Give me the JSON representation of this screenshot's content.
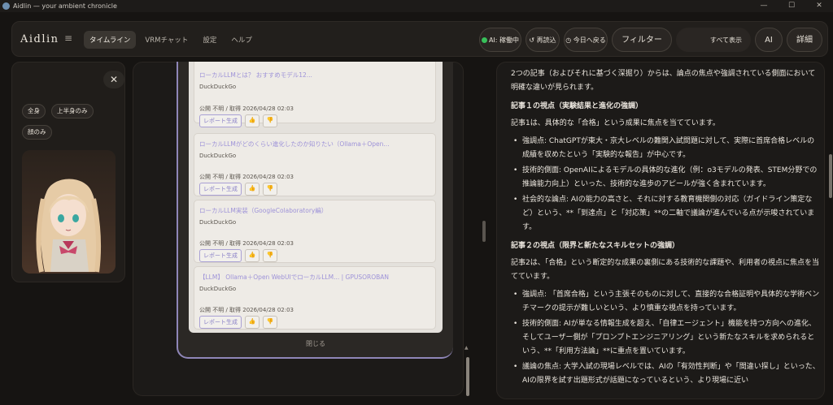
{
  "window": {
    "title": "Aidlin — your ambient chronicle",
    "min": "—",
    "max": "☐",
    "close": "✕"
  },
  "header": {
    "brand": "Aidlin",
    "menu_icon": "≡",
    "tabs": [
      {
        "label": "タイムライン",
        "active": true
      },
      {
        "label": "VRMチャット"
      },
      {
        "label": "設定"
      },
      {
        "label": "ヘルプ"
      }
    ],
    "status_ai": "AI: 稼働中",
    "reload": "↺ 再読込",
    "today": "今日へ戻る",
    "filter": "フィルター",
    "search_value": "すべて表示",
    "ai": "AI",
    "detail": "詳細",
    "status_color": "#38c05a"
  },
  "left": {
    "close": "✕",
    "chips": [
      "全身",
      "上半身のみ",
      "顔のみ"
    ]
  },
  "feed": {
    "top_title": "ローカルLLMとは？ おすすめモデル12...",
    "cards": [
      {
        "title": "ローカルLLMとは？ おすすめモデル12...",
        "source": "DuckDuckGo",
        "meta": "公開 不明 / 取得 2026/04/28 02:03",
        "report": "レポート生成"
      },
      {
        "title": "ローカルLLMがどのくらい進化したのか知りたい（Ollama＋Open...",
        "source": "DuckDuckGo",
        "meta": "公開 不明 / 取得 2026/04/28 02:03",
        "report": "レポート生成"
      },
      {
        "title": "ローカルLLM実装（GoogleColaboratory編）",
        "source": "DuckDuckGo",
        "meta": "公開 不明 / 取得 2026/04/28 02:03",
        "report": "レポート生成"
      },
      {
        "title": "【LLM】 Ollama＋Open WebUIでローカルLLM... | GPUSOROBAN",
        "source": "DuckDuckGo",
        "meta": "公開 不明 / 取得 2026/04/28 02:03",
        "report": "レポート生成"
      }
    ],
    "thumb_up": "👍",
    "thumb_down": "👎",
    "close_label": "閉じる"
  },
  "article": {
    "intro": "2つの記事（およびそれに基づく深掘り）からは、論点の焦点や強調されている側面において明確な違いが見られます。",
    "h1": "記事１の視点（実験結果と進化の強調）",
    "p1": "記事1は、具体的な「合格」という成果に焦点を当てています。",
    "list1": [
      "強調点: ChatGPTが東大・京大レベルの難関入試問題に対して、実際に首席合格レベルの成績を収めたという「実験的な報告」が中心です。",
      "技術的側面: OpenAIによるモデルの具体的な進化（例：o3モデルの発表、STEM分野での推論能力向上）といった、技術的な進歩のアピールが強く含まれています。",
      "社会的な論点: AIの能力の高さと、それに対する教育機関側の対応（ガイドライン策定など）という、**「到達点」と「対応策」**の二軸で議論が進んでいる点が示唆されています。"
    ],
    "h2": "記事２の視点（限界と新たなスキルセットの強調）",
    "p2": "記事2は、「合格」という断定的な成果の裏側にある技術的な課題や、利用者の視点に焦点を当てています。",
    "list2": [
      "強調点: 「首席合格」という主張そのものに対して、直接的な合格証明や具体的な学術ベンチマークの提示が難しいという、より慎重な視点を持っています。",
      "技術的側面: AIが単なる情報生成を超え、「自律エージェント」機能を持つ方向への進化、そしてユーザー側が「プロンプトエンジニアリング」という新たなスキルを求められるという、**「利用方法論」**に重点を置いています。",
      "議論の焦点: 大学入試の現場レベルでは、AIの「有効性判断」や「間違い探し」といった、AIの限界を試す出題形式が話題になっているという、より現場に近い"
    ]
  }
}
